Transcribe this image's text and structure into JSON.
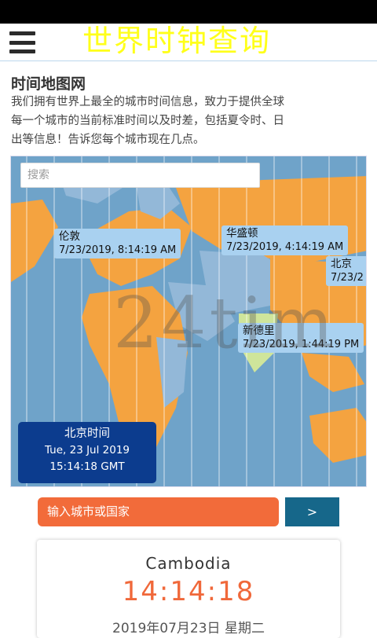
{
  "app": {
    "title": "世界时钟查询"
  },
  "intro": {
    "heading": "时间地图网",
    "line1": "我们拥有世界上最全的城市时间信息，致力于提供全球",
    "line2": "每一个城市的当前标准时间以及时差，包括夏令时、日",
    "line3": "出等信息！告诉您每个城市现在几点。"
  },
  "map": {
    "search_placeholder": "搜索",
    "watermark": "24tim",
    "cities": [
      {
        "name": "伦敦",
        "time": "7/23/2019, 8:14:19 AM"
      },
      {
        "name": "华盛顿",
        "time": "7/23/2019, 4:14:19 AM"
      },
      {
        "name": "北京",
        "time": "7/23/2"
      },
      {
        "name": "新德里",
        "time": "7/23/2019, 1:44:19 PM"
      }
    ],
    "local": {
      "title": "北京时间",
      "date": "Tue, 23 Jul 2019",
      "time": "15:14:18 GMT"
    },
    "colors": {
      "ocean": "#6fa3c9",
      "orange_zone": "#f4a340",
      "blue_zone": "#93b8d8",
      "green_zone": "#cfe59b"
    }
  },
  "query": {
    "placeholder": "输入城市或国家",
    "button_label": ">"
  },
  "result": {
    "country": "Cambodia",
    "time": "14:14:18",
    "date": "2019年07月23日 星期二"
  }
}
